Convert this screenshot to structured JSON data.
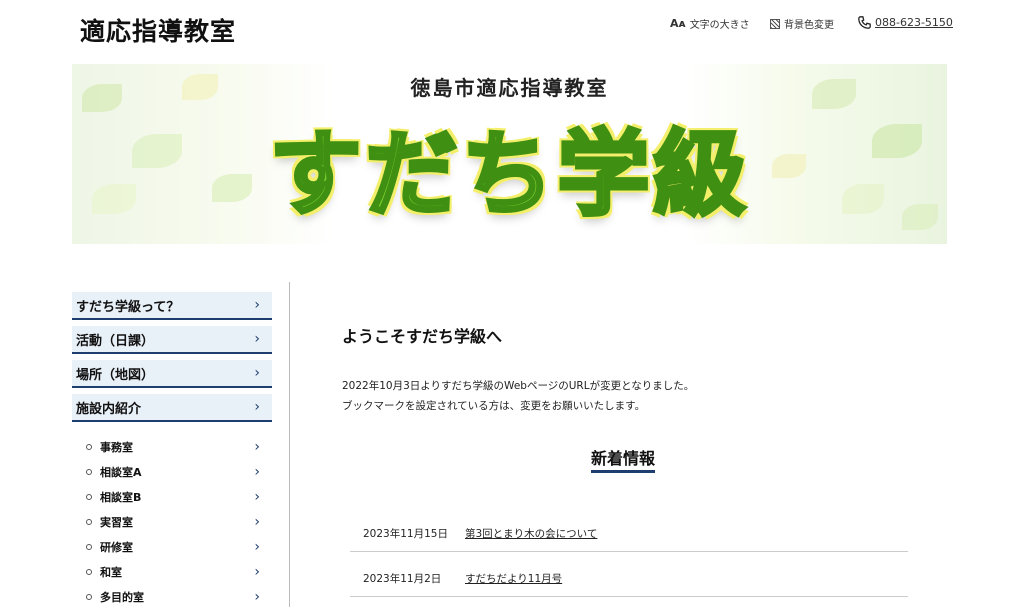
{
  "header": {
    "site_title": "適応指導教室",
    "font_size_icon": "Aᴀ",
    "font_size_label": "文字の大きさ",
    "bg_color_label": "背景色変更",
    "phone": "088-623-5150"
  },
  "banner": {
    "subtitle": "徳島市適応指導教室",
    "title": "すだち学級"
  },
  "sidebar": {
    "items": [
      {
        "label": "すだち学級って？"
      },
      {
        "label": "活動（日課）"
      },
      {
        "label": "場所（地図）"
      },
      {
        "label": "施設内紹介"
      }
    ],
    "sub_items": [
      {
        "label": "事務室"
      },
      {
        "label": "相談室A"
      },
      {
        "label": "相談室B"
      },
      {
        "label": "実習室"
      },
      {
        "label": "研修室"
      },
      {
        "label": "和室"
      },
      {
        "label": "多目的室"
      }
    ]
  },
  "main": {
    "heading": "ようこそすだち学級へ",
    "notice_line1": "2022年10月3日よりすだち学級のWebページのURLが変更となりました。",
    "notice_line2": "ブックマークを設定されている方は、変更をお願いいたします。",
    "news_heading": "新着情報",
    "news": [
      {
        "date": "2023年11月15日",
        "title": "第3回とまり木の会について"
      },
      {
        "date": "2023年11月2日",
        "title": "すだちだより11月号"
      }
    ]
  },
  "colors": {
    "accent_navy": "#1f3e70",
    "nav_bg": "#e8f0f8",
    "banner_green": "#7dcf2e"
  }
}
